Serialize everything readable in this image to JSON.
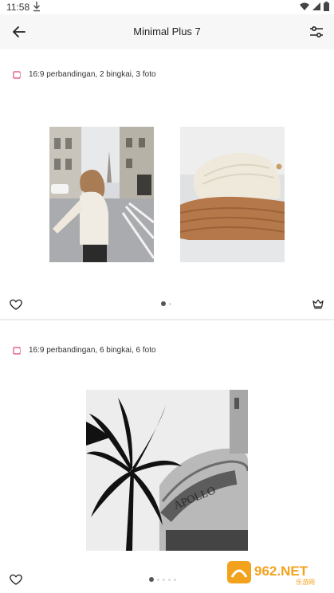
{
  "status_bar": {
    "time": "11:58",
    "icons": [
      "download-icon",
      "wifi-icon",
      "signal-icon",
      "battery-icon"
    ]
  },
  "app_bar": {
    "title": "Minimal Plus 7",
    "back_icon": "arrow-back-icon",
    "filter_icon": "tune-icon"
  },
  "templates": [
    {
      "description": "16:9 perbandingan, 2 bingkai, 3 foto",
      "photos": [
        "street-girl-paris-photo",
        "knit-sweater-photo"
      ],
      "pages": 2,
      "current_page": 1
    },
    {
      "description": "16:9 perbandingan, 6 bingkai, 6 foto",
      "photos": [
        "palm-apollo-building-photo"
      ],
      "pages": 5,
      "current_page": 1
    }
  ],
  "watermark": {
    "text": "962.NET",
    "subtext": "乐游网"
  },
  "colors": {
    "accent": "#e0457b",
    "appbar_bg": "#f7f7f7",
    "divider": "#ededed"
  }
}
